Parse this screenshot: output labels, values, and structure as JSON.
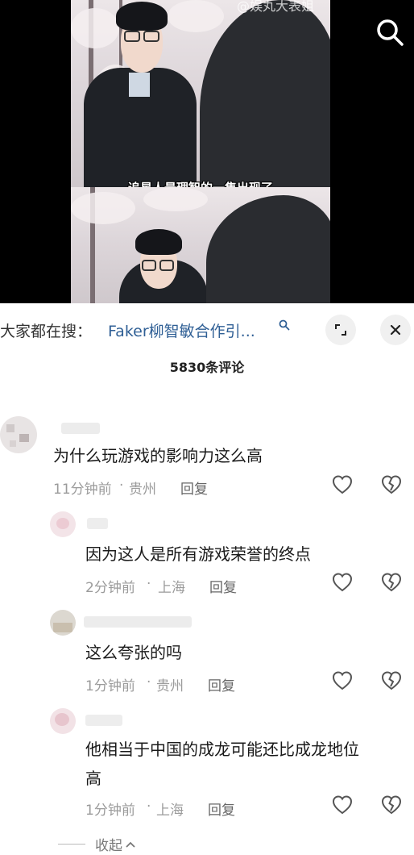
{
  "video": {
    "watermark": "@娱丸大表姐",
    "caption": "追星人最理智的一集出现了"
  },
  "search_bar": {
    "prefix": "大家都在搜：",
    "query": "Faker柳智敏合作引...",
    "icons": {
      "search": "search-icon",
      "expand": "expand-icon",
      "close": "close-icon"
    }
  },
  "comments_header": {
    "count_label": "5830条评论"
  },
  "comments": [
    {
      "text": "为什么玩游戏的影响力这么高",
      "time": "11分钟前",
      "location": "贵州",
      "reply": "回复"
    },
    {
      "text": "因为这人是所有游戏荣誉的终点",
      "time": "2分钟前",
      "location": "上海",
      "reply": "回复"
    },
    {
      "text": "这么夸张的吗",
      "time": "1分钟前",
      "location": "贵州",
      "reply": "回复"
    },
    {
      "text_line1": "他相当于中国的成龙可能还比成龙地位",
      "text_line2": "高",
      "time": "1分钟前",
      "location": "上海",
      "reply": "回复"
    }
  ],
  "collapse_label": "收起",
  "colors": {
    "link": "#2f5f95",
    "meta": "#9b9b9b",
    "text": "#1a1a1a"
  }
}
